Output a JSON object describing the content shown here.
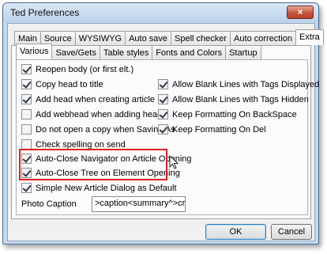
{
  "window": {
    "title": "Ted Preferences",
    "close_glyph": "×"
  },
  "tabs_outer": [
    {
      "label": "Main"
    },
    {
      "label": "Source"
    },
    {
      "label": "WYSIWYG"
    },
    {
      "label": "Auto save"
    },
    {
      "label": "Spell checker"
    },
    {
      "label": "Auto correction"
    },
    {
      "label": "Extra"
    }
  ],
  "tabs_inner": [
    {
      "label": "Various"
    },
    {
      "label": "Save/Gets"
    },
    {
      "label": "Table styles"
    },
    {
      "label": "Fonts and Colors"
    },
    {
      "label": "Startup"
    }
  ],
  "options_left": [
    {
      "label": "Reopen body (or first elt.)",
      "checked": true
    },
    {
      "label": "Copy head to title",
      "checked": true
    },
    {
      "label": "Add head when creating article",
      "checked": true
    },
    {
      "label": "Add webhead when adding head",
      "checked": false
    },
    {
      "label": "Do not open a copy when Saving As",
      "checked": false
    },
    {
      "label": "Check spelling on send",
      "checked": false
    },
    {
      "label": "Auto-Close Navigator on Article Opening",
      "checked": true
    },
    {
      "label": "Auto-Close Tree on Element Opening",
      "checked": true
    },
    {
      "label": "Simple New Article Dialog as Default",
      "checked": true
    }
  ],
  "options_right": [
    {
      "label": "Allow Blank Lines with Tags Displayed",
      "checked": true
    },
    {
      "label": "Allow Blank Lines with Tags Hidden",
      "checked": true
    },
    {
      "label": "Keep Formatting On BackSpace",
      "checked": true
    },
    {
      "label": "Keep Formatting On Del",
      "checked": true
    }
  ],
  "photo_caption": {
    "label": "Photo Caption",
    "value": ">caption<summary^>credit<authors^"
  },
  "buttons": {
    "ok": "OK",
    "cancel": "Cancel"
  },
  "colors": {
    "highlight_box": "#e02020",
    "titlebar": "#c4d7ec",
    "close_button": "#c7533c"
  }
}
